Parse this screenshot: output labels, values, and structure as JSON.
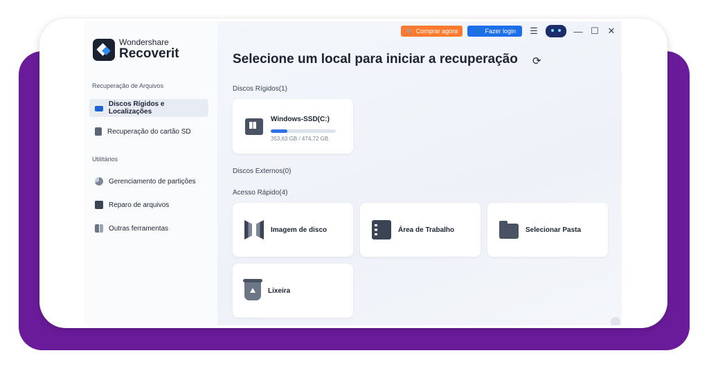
{
  "brand": {
    "company": "Wondershare",
    "product": "Recoverit"
  },
  "sidebar": {
    "section_recovery": "Recuperação de Arquivos",
    "section_utilities": "Utilitários",
    "items": [
      {
        "label": "Discos Rígidos e Localizações",
        "icon": "hard-drive-icon"
      },
      {
        "label": "Recuperação do cartão SD",
        "icon": "sd-card-icon"
      },
      {
        "label": "Gerenciamento de partições",
        "icon": "pie-chart-icon"
      },
      {
        "label": "Reparo de arquivos",
        "icon": "file-repair-icon"
      },
      {
        "label": "Outras ferramentas",
        "icon": "tools-icon"
      }
    ]
  },
  "topbar": {
    "buy_label": "Comprar agora",
    "login_label": "Fazer login",
    "menu_icon": "☰",
    "minimize_icon": "—",
    "maximize_icon": "☐",
    "close_icon": "✕",
    "buy_color": "#ff7a2e",
    "login_color": "#1c6fe8"
  },
  "main": {
    "title": "Selecione um local para iniciar a recuperação",
    "refresh_icon": "⟳",
    "hard_disks_label": "Discos Rígidos(1)",
    "drive": {
      "name": "Windows-SSD(C:)",
      "size": "353,63 GB / 474,72 GB",
      "used_fraction": 0.2545
    },
    "external_label": "Discos Externos(0)",
    "quick_label": "Acesso Rápido(4)",
    "quick": [
      {
        "label": "Imagem de disco",
        "icon": "disk-image-icon"
      },
      {
        "label": "Área de Trabalho",
        "icon": "desktop-icon"
      },
      {
        "label": "Selecionar Pasta",
        "icon": "folder-icon"
      },
      {
        "label": "Lixeira",
        "icon": "trash-icon"
      }
    ]
  }
}
